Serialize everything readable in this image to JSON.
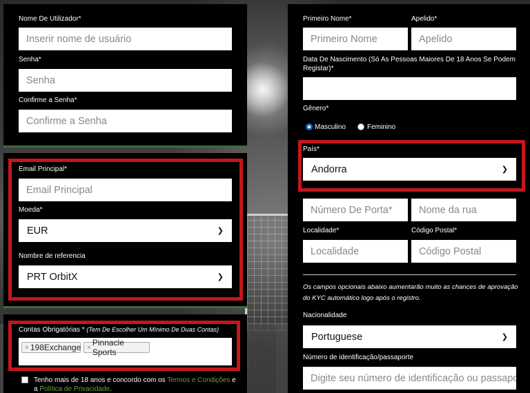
{
  "account": {
    "username_label": "Nome De Utilizador*",
    "username_placeholder": "Inserir nome de usuário",
    "password_label": "Senha*",
    "password_placeholder": "Senha",
    "confirm_label": "Confirme a Senha*",
    "confirm_placeholder": "Confirme a Senha"
  },
  "contact": {
    "email_label": "Email Principal*",
    "email_placeholder": "Email Principal",
    "currency_label": "Moeda*",
    "currency_value": "EUR",
    "reference_label": "Nombre de referencia",
    "reference_value": "PRT OrbitX"
  },
  "accounts": {
    "label": "Contas Obrigatórias * ",
    "hint": "(Tem De Escolher Um Mínimo De Duas Contas)",
    "tags": [
      "198Exchange",
      "Pinnacle Sports"
    ],
    "terms_text_1": "Tenho mais de 18 anos e concordo com os ",
    "terms_link": "Termos e Condições",
    "terms_text_2": " e",
    "terms_text_3": "a ",
    "privacy_link": "Política de Privacidade",
    "terms_text_4": "."
  },
  "personal": {
    "first_name_label": "Primeiro Nome*",
    "first_name_placeholder": "Primeiro Nome",
    "last_name_label": "Apelido*",
    "last_name_placeholder": "Apelido",
    "dob_label_1": "Data De Nascimento (Só As Pessoas Maiores De 18 Anos Se Podem",
    "dob_label_2": "Registar)*",
    "gender_label": "Gênero*",
    "gender_male": "Masculino",
    "gender_female": "Feminino",
    "country_label": "País*",
    "country_value": "Andorra",
    "door_placeholder": "Número De Porta*",
    "street_placeholder": "Nome da rua",
    "city_label": "Localidade*",
    "city_placeholder": "Localidade",
    "postal_label": "Código Postal*",
    "postal_placeholder": "Código Postal",
    "optional_note_1": "Os campos opcionais abaixo aumentarão muito as chances de aprovação",
    "optional_note_2": "do KYC automático logo após o registro.",
    "nationality_label": "Nacionalidade",
    "nationality_value": "Portuguese",
    "id_label": "Número de identificação/passaporte",
    "id_placeholder": "Digite seu número de identificação ou passaporte"
  },
  "colors": {
    "highlight_red": "#c4161c",
    "link_green": "#5fa83f",
    "radio_blue": "#1a66d6"
  }
}
